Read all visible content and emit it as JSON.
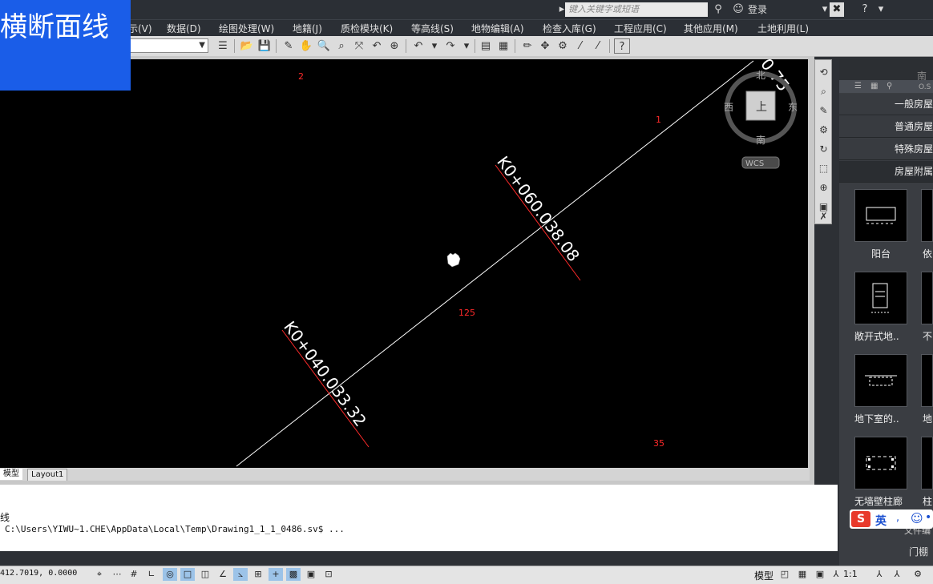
{
  "titlebar": {
    "search_placeholder": "键入关键字或短语",
    "login": "登录"
  },
  "menu": [
    "示(V)",
    "数据(D)",
    "绘图处理(W)",
    "地籍(J)",
    "质检模块(K)",
    "等高线(S)",
    "地物编辑(A)",
    "检查入库(G)",
    "工程应用(C)",
    "其他应用(M)",
    "土地利用(L)"
  ],
  "drawing": {
    "section_lines": [
      {
        "chainage": "K0+060.0",
        "length": "38.08"
      },
      {
        "chainage": "K0+040.0",
        "length": "33.32"
      },
      {
        "partial_label": "0.75"
      }
    ],
    "point_labels": [
      "2",
      "1",
      "125",
      "35"
    ]
  },
  "viewcube": {
    "north": "北",
    "south": "南",
    "east": "东",
    "west": "西",
    "top": "上",
    "wcs": "WCS"
  },
  "layout_tabs": [
    "模型",
    "Layout1"
  ],
  "command": {
    "line1": "线",
    "line2": "C:\\Users\\YIWU~1.CHE\\AppData\\Local\\Temp\\Drawing1_1_1_0486.sv$ ..."
  },
  "status": {
    "coords": "412.7019, 0.0000",
    "model_label": "模型",
    "scale": "1:1"
  },
  "palette": {
    "south": "南",
    "os": "O.S",
    "categories": [
      "一般房屋",
      "普通房屋",
      "特殊房屋",
      "房屋附属"
    ],
    "items": [
      {
        "label": "阳台",
        "icon": "balcony-icon"
      },
      {
        "label": "依",
        "icon": "partial-icon"
      },
      {
        "label": "敞开式地..",
        "icon": "open-basement-icon"
      },
      {
        "label": "不",
        "icon": "partial-icon"
      },
      {
        "label": "地下室的..",
        "icon": "basement-icon"
      },
      {
        "label": "地",
        "icon": "partial-icon"
      },
      {
        "label": "无墙壁柱廊",
        "icon": "wall-less-colonnade-icon"
      },
      {
        "label": "柱",
        "icon": "partial-icon"
      }
    ],
    "footer1": "文件编",
    "footer2": "门棚"
  },
  "ime": {
    "lang": "英"
  },
  "overlay": {
    "title": "横断面线"
  }
}
